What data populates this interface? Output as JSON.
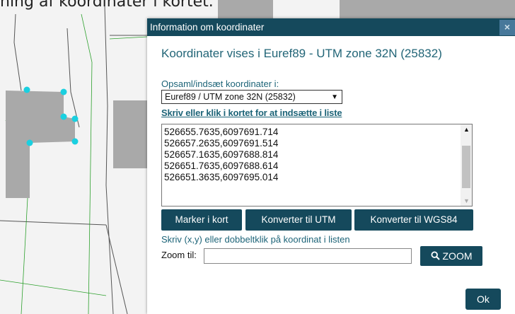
{
  "map": {
    "caption": "ning af koordinater i kortet."
  },
  "dialog": {
    "title": "Information om koordinater",
    "close_glyph": "×",
    "heading": "Koordinater vises i Euref89 - UTM zone 32N (25832)",
    "collect_label": "Opsaml/indsæt koordinater i:",
    "crs_select_value": "Euref89 / UTM zone 32N (25832)",
    "write_label": "Skriv eller klik i kortet for at indsætte i liste",
    "coordinates": [
      "526655.7635,6097691.714",
      "526657.2635,6097691.514",
      "526657.1635,6097688.814",
      "526651.7635,6097688.614",
      "526651.3635,6097695.014"
    ],
    "buttons": {
      "mark": "Marker i kort",
      "to_utm": "Konverter til UTM",
      "to_wgs84": "Konverter til WGS84"
    },
    "hint": "Skriv (x,y) eller dobbeltklik på koordinat i listen",
    "zoom_label": "Zoom til:",
    "zoom_value": "",
    "zoom_button": "ZOOM",
    "ok_button": "Ok"
  },
  "colors": {
    "titlebar": "#15495c",
    "accent_text": "#226577",
    "vertex": "#1ad0e0",
    "building": "#a9a9a9"
  }
}
